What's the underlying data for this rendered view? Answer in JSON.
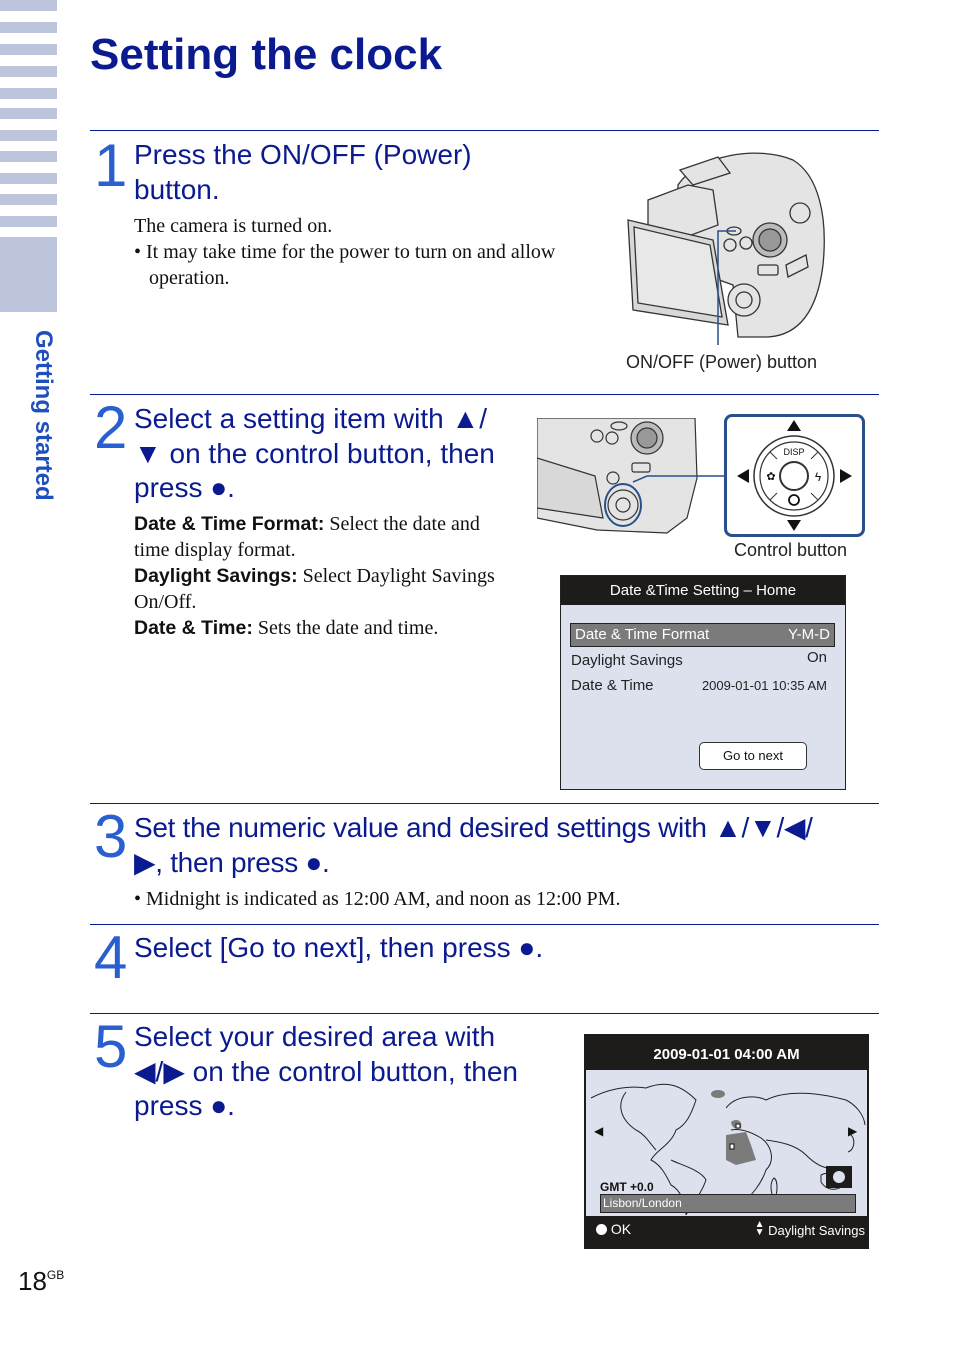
{
  "sidebar": {
    "section_label": "Getting started",
    "stripe_color": "#bcc5dc",
    "label_color": "#1f4fbf"
  },
  "page": {
    "title": "Setting the clock",
    "number": "18",
    "number_suffix": "GB",
    "title_color": "#0b1b8f",
    "step_number_color": "#2a5fcf"
  },
  "steps": [
    {
      "number": "1",
      "heading_lines": [
        "Press the ON/OFF (Power)",
        "button."
      ],
      "body": "The camera is turned on.",
      "bullets": [
        "It may take time for the power to turn on and allow operation."
      ],
      "figure_caption": "ON/OFF (Power) button"
    },
    {
      "number": "2",
      "heading_lines": [
        "Select a setting item with ▲/",
        "▼ on the control button, then",
        "press ●."
      ],
      "definitions": [
        {
          "term": "Date & Time Format:",
          "desc": "Select the date and time display format."
        },
        {
          "term": "Daylight Savings:",
          "desc": "Select Daylight Savings On/Off."
        },
        {
          "term": "Date & Time:",
          "desc": "Sets the date and time."
        }
      ],
      "figure_caption": "Control button",
      "control_button": {
        "top_label": "DISP",
        "up": "▲",
        "down": "▼",
        "left": "◀",
        "right": "▶"
      },
      "screen": {
        "title": "Date &Time Setting – Home",
        "rows": [
          {
            "label": "Date &  Time Format",
            "value": "Y-M-D",
            "selected": true
          },
          {
            "label": "Daylight Savings",
            "value": "On",
            "selected": false
          },
          {
            "label": "Date & Time",
            "value": "2009-01-01  10:35 AM",
            "selected": false
          }
        ],
        "button": "Go to next"
      }
    },
    {
      "number": "3",
      "heading_lines": [
        "Set the numeric value and desired settings with ▲/▼/◀/",
        "▶, then press ●."
      ],
      "bullets": [
        "Midnight is indicated as 12:00 AM, and noon as 12:00 PM."
      ]
    },
    {
      "number": "4",
      "heading_lines": [
        "Select [Go to next], then press ●."
      ]
    },
    {
      "number": "5",
      "heading_lines": [
        "Select your desired area with",
        "◀/▶ on the control button, then",
        "press ●."
      ],
      "screen": {
        "datetime": "2009-01-01 04:00 AM",
        "gmt": "GMT +0.0",
        "city": "Lisbon/London",
        "ok_label": "OK",
        "daylight_label": "Daylight Savings",
        "left_arrow": "◀",
        "right_arrow": "▶"
      }
    }
  ]
}
